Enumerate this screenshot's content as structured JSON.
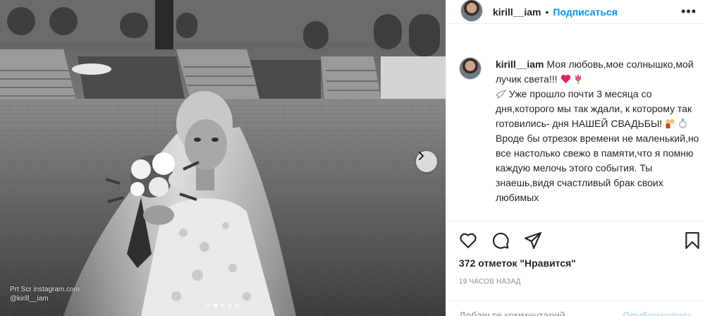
{
  "post": {
    "username": "kirill__iam",
    "separator": "•",
    "follow_label": "Подписаться",
    "more_icon": "more-horizontal-icon"
  },
  "caption": {
    "username": "kirill__iam",
    "line1": "Моя любовь,мое солнышко,мой лучик света!!!",
    "line2": "Уже прошло почти 3 месяца со дня,которого мы так ждали, к которому так готовились- дня НАШЕЙ СВАДЬБЫ!",
    "line3": "Вроде бы отрезок времени не маленький,но все настолько свежо в памяти,что я помню каждую мелочь этого события. Ты знаешь,видя счастливый брак своих любимых"
  },
  "stats": {
    "likes": "372 отметок \"Нравится\"",
    "time": "19 часов назад"
  },
  "composer": {
    "placeholder": "Добавьте комментарий...",
    "post_label": "Опубликовать"
  },
  "photo": {
    "watermark_line1": "Prt Scr instagram.com",
    "watermark_line2": "@kirill__iam",
    "carousel_active_index": 1,
    "carousel_count": 5
  },
  "colors": {
    "accent": "#0095f6",
    "text": "#262626",
    "muted": "#8e8e8e",
    "border": "#efefef"
  }
}
